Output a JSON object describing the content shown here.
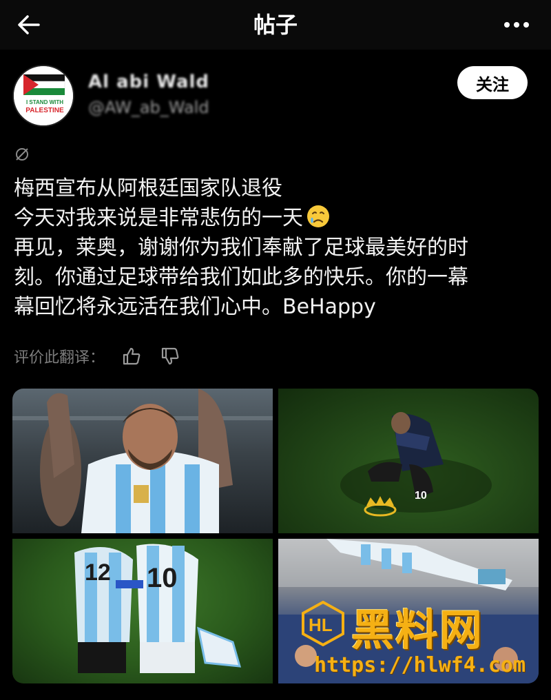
{
  "header": {
    "title": "帖子",
    "back_icon": "arrow-left-icon",
    "more_icon": "more-horizontal-icon"
  },
  "author": {
    "name": "Al abi Wald",
    "handle": "@AW_ab_Wald",
    "follow_label": "关注",
    "avatar_text_line1": "I STAND WITH",
    "avatar_text_line2": "PALESTINE"
  },
  "post": {
    "lines": [
      "梅西宣布从阿根廷国家队退役",
      "今天对我来说是非常悲伤的一天",
      "再见，莱奥，谢谢你为我们奉献了足球最美好的时",
      "刻。你通过足球带给我们如此多的快乐。你的一幕",
      "幕回忆将永远活在我们心中。BeHappy"
    ],
    "emoji": "sad-but-relieved-face-emoji"
  },
  "translation": {
    "rate_label": "评价此翻译：",
    "like_icon": "thumbs-up-icon",
    "dislike_icon": "thumbs-down-icon"
  },
  "media": {
    "count": 4,
    "jersey_number": "10"
  },
  "watermark": {
    "title": "黑料网",
    "url": "https://hlwf4.com"
  },
  "colors": {
    "background": "#000000",
    "text": "#f2f2f2",
    "muted": "#7d7d7d",
    "watermark": "#f5b014"
  }
}
